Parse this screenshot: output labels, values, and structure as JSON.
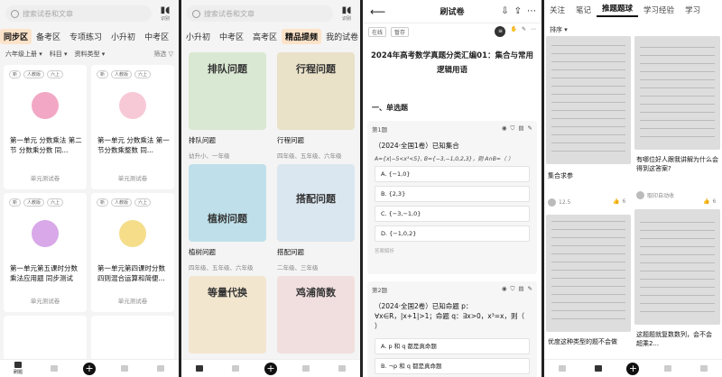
{
  "colors": {
    "accent": "#f7931e",
    "tab_bg": "#fde3c9",
    "pink": "#f2a8c4",
    "yellow": "#f5dd8a",
    "purple": "#d8a8e8"
  },
  "panel1": {
    "search_placeholder": "搜索试卷和文章",
    "voice_label": "识别",
    "tabs": [
      "同步区",
      "备考区",
      "专项练习",
      "小升初",
      "中考区"
    ],
    "filters": {
      "grade": "六年级上册",
      "subject": "科目",
      "type": "资料类型",
      "sort": "筛选"
    },
    "cards": [
      {
        "badges": [
          "新",
          "人教版",
          "六上"
        ],
        "title": "第一单元 分数乘法 第二节 分数乘分数 同...",
        "sub": "单元测试卷"
      },
      {
        "badges": [
          "新",
          "人教版",
          "六上"
        ],
        "title": "第一单元 分数乘法 第一节分数乘整数 同...",
        "sub": "单元测试卷"
      },
      {
        "badges": [
          "新",
          "人教版",
          "六上"
        ],
        "title": "第一单元第五课时分数乘法应用题 同步测试",
        "sub": "单元测试卷"
      },
      {
        "badges": [
          "新",
          "人教版",
          "六上"
        ],
        "title": "第一单元第四课时分数四则混合运算和简便...",
        "sub": "单元测试卷"
      }
    ],
    "nav": [
      "刷题",
      "",
      "",
      "",
      ""
    ]
  },
  "panel2": {
    "search_placeholder": "搜索试卷和文章",
    "voice_label": "识别",
    "tabs": [
      "小升初",
      "中考区",
      "高考区",
      "精品提频",
      "我的试卷"
    ],
    "cards": [
      {
        "img_text": "排队问题",
        "title": "排队问题",
        "sub": "幼升小、一年级",
        "bg": "#d9e8d2"
      },
      {
        "img_text": "行程问题",
        "title": "行程问题",
        "sub": "四年级、五年级、六年级",
        "bg": "#e9e1c8"
      },
      {
        "img_text": "植树问题",
        "title": "植树问题",
        "sub": "四年级、五年级、六年级",
        "bg": "#bfe0ea"
      },
      {
        "img_text": "搭配问题",
        "title": "搭配问题",
        "sub": "二年级、三年级",
        "bg": "#dbe7f0"
      },
      {
        "img_text": "等量代换",
        "title": "",
        "sub": "",
        "bg": "#f3e6cf"
      },
      {
        "img_text": "鸡浦简数",
        "title": "",
        "sub": "",
        "bg": "#f1dfe0"
      }
    ]
  },
  "panel3": {
    "title": "刷试卷",
    "chips": [
      "在线",
      "暂存"
    ],
    "doc_title": "2024年高考数学真题分类汇编01：集合与常用逻辑用语",
    "section": "一、单选题",
    "q1": {
      "label": "第1题",
      "text": "（2024·全国1卷）已知集合",
      "math": "A={x|−5<x³<5}, B={−3,−1,0,2,3}，则 A∩B=（ ）",
      "options": [
        "A. {−1,0}",
        "B. {2,3}",
        "C. {−3,−1,0}",
        "D. {−1,0,2}"
      ],
      "foot": "答案解析"
    },
    "q2": {
      "label": "第2题",
      "text": "（2024·全国2卷）已知命题 p：∀x∈R，|x+1|>1；命题 q：∃x>0，x³=x，则（ ）",
      "options": [
        "A. p 和 q 都是真命题",
        "B. ¬p 和 q 都是真命题"
      ]
    }
  },
  "panel4": {
    "tabs": [
      "关注",
      "笔记",
      "推题题球",
      "学习经验",
      "学习"
    ],
    "sort": "排序",
    "posts": [
      {
        "caption": "集合求参",
        "user": "12.5",
        "likes": "6"
      },
      {
        "caption": "有哪位好人跟我讲解为什么会得到这答案?",
        "user": "取印自动收",
        "likes": "6"
      },
      {
        "caption": "优度这种类型的题不会做",
        "user": "",
        "likes": ""
      },
      {
        "caption": "这题题就复数数列，会不会 超乘2...",
        "user": "",
        "likes": ""
      }
    ]
  }
}
